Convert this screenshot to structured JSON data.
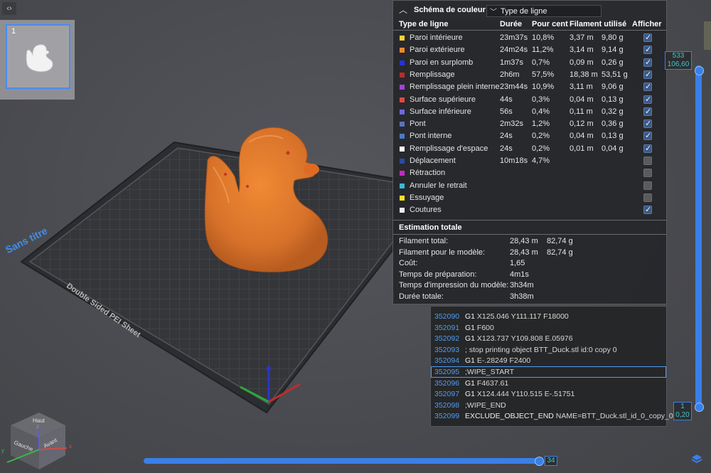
{
  "plate": {
    "number": "1",
    "name": "Sans titre",
    "sheet": "Double Sided PEI Sheet"
  },
  "scheme": {
    "title": "Schéma de couleur",
    "selected": "Type de ligne"
  },
  "table": {
    "headers": {
      "type": "Type de ligne",
      "duration": "Durée",
      "percent": "Pour cent",
      "filament": "Filament utilisé",
      "show": "Afficher"
    },
    "rows": [
      {
        "name": "Paroi intérieure",
        "color": "#f2d13c",
        "duration": "23m37s",
        "percent": "10,8%",
        "length": "3,37 m",
        "weight": "9,80 g",
        "shown": true
      },
      {
        "name": "Paroi extérieure",
        "color": "#f08a2a",
        "duration": "24m24s",
        "percent": "11,2%",
        "length": "3,14 m",
        "weight": "9,14 g",
        "shown": true
      },
      {
        "name": "Paroi en surplomb",
        "color": "#2233e0",
        "duration": "1m37s",
        "percent": "0,7%",
        "length": "0,09 m",
        "weight": "0,26 g",
        "shown": true
      },
      {
        "name": "Remplissage",
        "color": "#b0302d",
        "duration": "2h6m",
        "percent": "57,5%",
        "length": "18,38 m",
        "weight": "53,51 g",
        "shown": true
      },
      {
        "name": "Remplissage plein interne",
        "color": "#a044d8",
        "duration": "23m44s",
        "percent": "10,9%",
        "length": "3,11 m",
        "weight": "9,06 g",
        "shown": true
      },
      {
        "name": "Surface supérieure",
        "color": "#e24848",
        "duration": "44s",
        "percent": "0,3%",
        "length": "0,04 m",
        "weight": "0,13 g",
        "shown": true
      },
      {
        "name": "Surface inférieure",
        "color": "#6a6ae0",
        "duration": "56s",
        "percent": "0,4%",
        "length": "0,11 m",
        "weight": "0,32 g",
        "shown": true
      },
      {
        "name": "Pont",
        "color": "#5a72b8",
        "duration": "2m32s",
        "percent": "1,2%",
        "length": "0,12 m",
        "weight": "0,36 g",
        "shown": true
      },
      {
        "name": "Pont interne",
        "color": "#4a7ac2",
        "duration": "24s",
        "percent": "0,2%",
        "length": "0,04 m",
        "weight": "0,13 g",
        "shown": true
      },
      {
        "name": "Remplissage d'espace",
        "color": "#ffffff",
        "duration": "24s",
        "percent": "0,2%",
        "length": "0,01 m",
        "weight": "0,04 g",
        "shown": true
      },
      {
        "name": "Déplacement",
        "color": "#2a4aa8",
        "duration": "10m18s",
        "percent": "4,7%",
        "length": "",
        "weight": "",
        "shown": false
      },
      {
        "name": "Rétraction",
        "color": "#c42ac4",
        "duration": "",
        "percent": "",
        "length": "",
        "weight": "",
        "shown": false
      },
      {
        "name": "Annuler le retrait",
        "color": "#3cb8d8",
        "duration": "",
        "percent": "",
        "length": "",
        "weight": "",
        "shown": false
      },
      {
        "name": "Essuyage",
        "color": "#f2e02a",
        "duration": "",
        "percent": "",
        "length": "",
        "weight": "",
        "shown": false
      },
      {
        "name": "Coutures",
        "color": "#eeeeee",
        "duration": "",
        "percent": "",
        "length": "",
        "weight": "",
        "shown": true
      }
    ]
  },
  "estimate": {
    "title": "Estimation totale",
    "rows": [
      {
        "label": "Filament total:",
        "v1": "28,43 m",
        "v2": "82,74 g"
      },
      {
        "label": "Filament pour le modèle:",
        "v1": "28,43 m",
        "v2": "82,74 g"
      },
      {
        "label": "Coût:",
        "v1": "1,65",
        "v2": ""
      },
      {
        "label": "Temps de préparation:",
        "v1": "4m1s",
        "v2": ""
      },
      {
        "label": "Temps d'impression du modèle:",
        "v1": "3h34m",
        "v2": ""
      },
      {
        "label": "Durée totale:",
        "v1": "3h38m",
        "v2": ""
      }
    ]
  },
  "gcode": [
    {
      "line": "352090",
      "cmd": "G1",
      "rest": " X125.046 Y111.117 F18000",
      "selected": false
    },
    {
      "line": "352091",
      "cmd": "G1",
      "rest": " F600",
      "selected": false
    },
    {
      "line": "352092",
      "cmd": "G1",
      "rest": " X123.737 Y109.808 E.05976",
      "selected": false
    },
    {
      "line": "352093",
      "cmd": "",
      "rest": "; stop printing object BTT_Duck.stl id:0 copy 0",
      "selected": false
    },
    {
      "line": "352094",
      "cmd": "G1",
      "rest": " E-.28249 F2400",
      "selected": false
    },
    {
      "line": "352095",
      "cmd": "",
      "rest": ";WIPE_START",
      "selected": true
    },
    {
      "line": "352096",
      "cmd": "G1",
      "rest": " F4637.61",
      "selected": false
    },
    {
      "line": "352097",
      "cmd": "G1",
      "rest": " X124.444 Y110.515 E-.51751",
      "selected": false
    },
    {
      "line": "352098",
      "cmd": "",
      "rest": ";WIPE_END",
      "selected": false
    },
    {
      "line": "352099",
      "cmd": "EXCLUDE_OBJECT_END",
      "rest": " NAME=BTT_Duck.stl_id_0_copy_0",
      "selected": false
    }
  ],
  "layer_slider": {
    "top_layer": "533",
    "top_height": "106,60",
    "bottom_layer": "1",
    "bottom_height": "0,20"
  },
  "move_slider": {
    "value": "34"
  },
  "view_cube": {
    "top": "Haut",
    "left": "Gauche",
    "front": "Avant",
    "axis_x": "x",
    "axis_y": "y",
    "axis_z": "z"
  },
  "colors": {
    "accent": "#3a7fe8",
    "model": "#e07a2c"
  }
}
